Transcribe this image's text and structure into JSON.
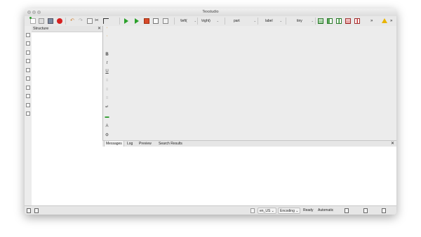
{
  "window": {
    "title": "Texstudio"
  },
  "toolbar": {
    "dropdowns": [
      {
        "label": "\\left("
      },
      {
        "label": "\\right)"
      },
      {
        "label": "part"
      },
      {
        "label": "label"
      },
      {
        "label": "tiny"
      }
    ],
    "overflow_label": "»",
    "overflow2_label": "»"
  },
  "structure": {
    "title": "Structure",
    "close": "✕"
  },
  "format": {
    "bold": "B",
    "italic": "I",
    "underline": "U"
  },
  "messages": {
    "tabs": [
      {
        "label": "Messages"
      },
      {
        "label": "Log"
      },
      {
        "label": "Preview"
      },
      {
        "label": "Search Results"
      }
    ],
    "close": "✕"
  },
  "status": {
    "language": "en_US",
    "encoding": "Encoding",
    "ready": "Ready",
    "mode": "Automatic"
  },
  "colors": {
    "run_green": "#2aa02a",
    "stop_red": "#d62020",
    "warning_yellow": "#e8b400"
  }
}
